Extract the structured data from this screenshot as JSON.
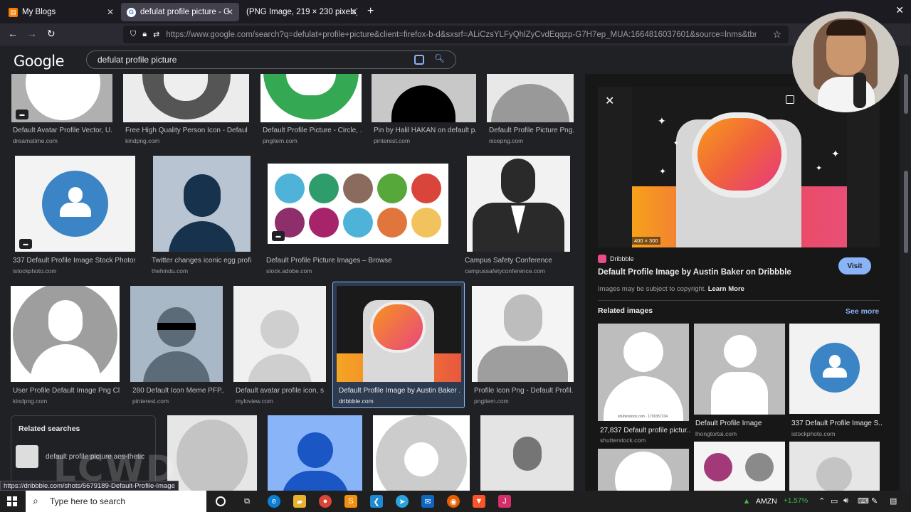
{
  "browser": {
    "tabs": [
      {
        "label": "My Blogs"
      },
      {
        "label": "defulat profile picture - Google Search"
      },
      {
        "label": "(PNG Image, 219 × 230 pixels)"
      }
    ],
    "url": "https://www.google.com/search?q=defulat+profile+picture&client=firefox-b-d&sxsrf=ALiCzsYLFyQhlZyCvdEqqzp-G7H7ep_MUA:1664816037601&source=lnms&tbm=isch&sa",
    "url_host": "https://www.google.com"
  },
  "google": {
    "logo": "Google",
    "query": "defulat profile picture"
  },
  "results": [
    {
      "title": "Default Avatar Profile Vector, U...",
      "source": "dreamstime.com"
    },
    {
      "title": "Free High Quality Person Icon - Default ...",
      "source": "kindpng.com"
    },
    {
      "title": "Default Profile Picture - Circle, ...",
      "source": "pngitem.com"
    },
    {
      "title": "Pin by Halil HAKAN on default p...",
      "source": "pinterest.com"
    },
    {
      "title": "Default Profile Picture Png...",
      "source": "nicepng.com"
    },
    {
      "title": "337 Default Profile Image Stock Photos ...",
      "source": "istockphoto.com"
    },
    {
      "title": "Twitter changes iconic egg profi...",
      "source": "thehindu.com"
    },
    {
      "title": "Default Profile Picture Images – Browse ...",
      "source": "stock.adobe.com"
    },
    {
      "title": "Campus Safety Conference",
      "source": "campussafetyconference.com"
    },
    {
      "title": "User Profile Default Image Png Cl...",
      "source": "kindpng.com"
    },
    {
      "title": "280 Default Icon Meme PFP...",
      "source": "pinterest.com"
    },
    {
      "title": "Default avatar profile icon, s...",
      "source": "myloview.com"
    },
    {
      "title": "Default Profile Image by Austin Baker ...",
      "source": "dribbble.com"
    },
    {
      "title": "Profile Icon Png - Default Profil...",
      "source": "pngitem.com"
    }
  ],
  "related_searches": {
    "title": "Related searches",
    "item": "default profile picture aes-thetic"
  },
  "watermark": "LCWD",
  "status_link": "https://dribbble.com/shots/5679189-Default-Profile-Image",
  "panel": {
    "size_label": "400 × 300",
    "site": "Dribbble",
    "title": "Default Profile Image by Austin Baker on Dribbble",
    "visit": "Visit",
    "copyright": "Images may be subject to copyright.",
    "learn_more": "Learn More",
    "related_title": "Related images",
    "see_more": "See more",
    "related": [
      {
        "title": "27,837 Default profile pictur...",
        "source": "shutterstock.com",
        "caption": "shutterstock.com · 1700357234"
      },
      {
        "title": "Default Profile Image",
        "source": "lhongtortai.com"
      },
      {
        "title": "337 Default Profile Image S...",
        "source": "istockphoto.com"
      }
    ]
  },
  "taskbar": {
    "search_placeholder": "Type here to search",
    "stock_name": "AMZN",
    "stock_change": "+1.57%"
  },
  "colors": {
    "accent": "#8ab4f8",
    "page_bg": "#202124",
    "panel_bg": "#171717"
  }
}
